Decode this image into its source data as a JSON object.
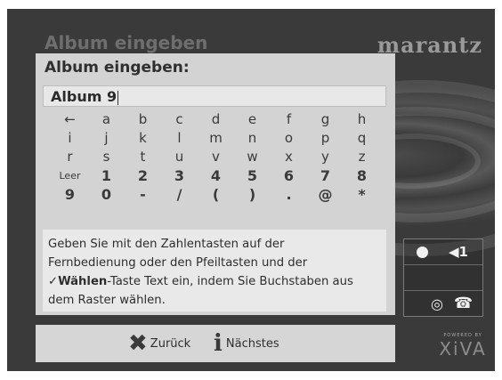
{
  "background": {
    "title": "Album eingeben",
    "brand": "marantz",
    "xiva_small": "POWERED BY",
    "xiva": "XiVA"
  },
  "dialog": {
    "title": "Album eingeben:",
    "input_value": "Album 9",
    "keyboard_rows": [
      [
        "←",
        "a",
        "b",
        "c",
        "d",
        "e",
        "f",
        "g",
        "h"
      ],
      [
        "i",
        "j",
        "k",
        "l",
        "m",
        "n",
        "o",
        "p",
        "q"
      ],
      [
        "r",
        "s",
        "t",
        "u",
        "v",
        "w",
        "x",
        "y",
        "z"
      ],
      [
        "Leer",
        "1",
        "2",
        "3",
        "4",
        "5",
        "6",
        "7",
        "8"
      ],
      [
        "9",
        "0",
        "-",
        "/",
        "(",
        ")",
        ".",
        "@",
        "*"
      ]
    ],
    "help": {
      "line1": "Geben Sie mit den Zahlentasten auf der",
      "line2": "Fernbedienung oder den Pfeiltasten und der",
      "line3_check": "✓",
      "line3_bold": "Wählen",
      "line3_rest": "-Taste Text ein, indem Sie Buchstaben aus",
      "line4": "dem Raster wählen."
    }
  },
  "status": {
    "speaker": "◀1",
    "cd": "◎",
    "phone": "☎"
  },
  "bottom": {
    "back_label": "Zurück",
    "next_label": "Nächstes",
    "back_icon": "✖",
    "next_icon": "i"
  }
}
